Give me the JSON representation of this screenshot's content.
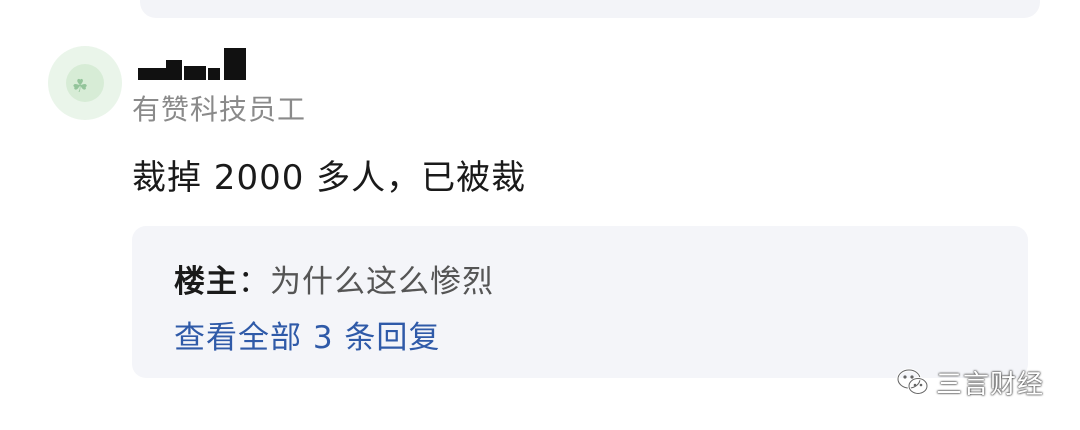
{
  "comment": {
    "role": "有赞科技员工",
    "content": "裁掉 2000 多人，已被裁"
  },
  "reply": {
    "author": "楼主",
    "separator": "：",
    "text": "为什么这么惨烈",
    "view_all": "查看全部 3 条回复"
  },
  "watermark": {
    "text": "三言财经",
    "icon": "wechat-icon"
  },
  "colors": {
    "link": "#2f5aa8",
    "reply_bg": "#f4f5f9",
    "role": "#8a8a8a"
  }
}
